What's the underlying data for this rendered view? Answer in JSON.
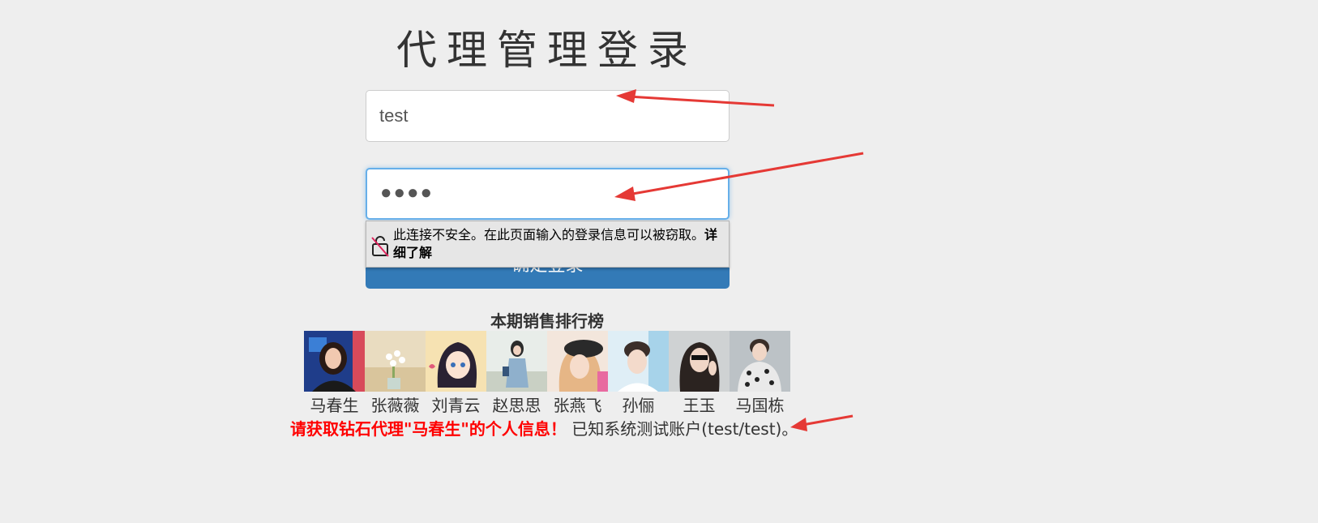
{
  "page": {
    "title": "代理管理登录"
  },
  "login": {
    "username_value": "test",
    "password_value": "●●●●",
    "button_label": "确定登录"
  },
  "warning": {
    "text": "此连接不安全。在此页面输入的登录信息可以被窃取。",
    "link": "详细了解"
  },
  "ranking": {
    "title": "本期销售排行榜",
    "agents": [
      {
        "name": "马春生",
        "photo": "avatar-1"
      },
      {
        "name": "张薇薇",
        "photo": "avatar-2"
      },
      {
        "name": "刘青云",
        "photo": "avatar-3"
      },
      {
        "name": "赵思思",
        "photo": "avatar-4"
      },
      {
        "name": "张燕飞",
        "photo": "avatar-5"
      },
      {
        "name": "孙俪",
        "photo": "avatar-6"
      },
      {
        "name": "王玉",
        "photo": "avatar-7"
      },
      {
        "name": "马国栋",
        "photo": "avatar-8"
      }
    ]
  },
  "hint": {
    "red": "请获取钻石代理\"马春生\"的个人信息！",
    "normal": "已知系统测试账户(test/test)。"
  },
  "colors": {
    "primary": "#337ab7",
    "warning_text": "#ff0000",
    "arrow": "#e53935"
  }
}
